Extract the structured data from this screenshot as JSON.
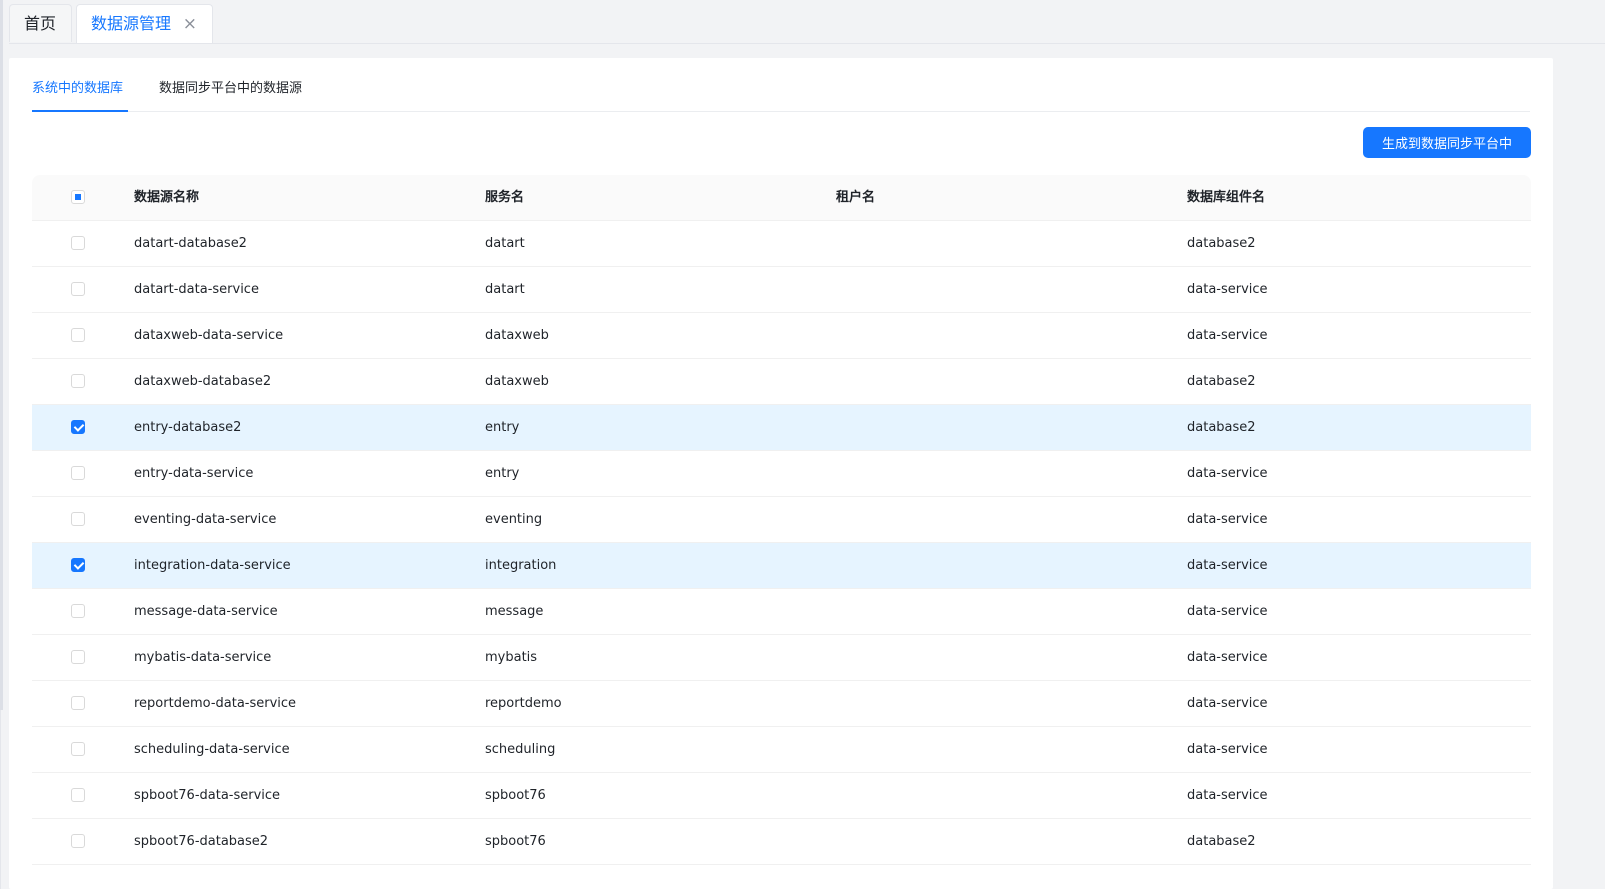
{
  "page_tabs": {
    "home_label": "首页",
    "active_label": "数据源管理",
    "close_glyph": "×"
  },
  "inner_tabs": [
    {
      "label": "系统中的数据库"
    },
    {
      "label": "数据同步平台中的数据源"
    }
  ],
  "toolbar": {
    "generate_label": "生成到数据同步平台中"
  },
  "table": {
    "columns": [
      "数据源名称",
      "服务名",
      "租户名",
      "数据库组件名"
    ],
    "header_checkbox": "indeterminate",
    "rows": [
      {
        "name": "datart-database2",
        "service": "datart",
        "tenant": "",
        "component": "database2",
        "checked": false
      },
      {
        "name": "datart-data-service",
        "service": "datart",
        "tenant": "",
        "component": "data-service",
        "checked": false
      },
      {
        "name": "dataxweb-data-service",
        "service": "dataxweb",
        "tenant": "",
        "component": "data-service",
        "checked": false
      },
      {
        "name": "dataxweb-database2",
        "service": "dataxweb",
        "tenant": "",
        "component": "database2",
        "checked": false
      },
      {
        "name": "entry-database2",
        "service": "entry",
        "tenant": "",
        "component": "database2",
        "checked": true
      },
      {
        "name": "entry-data-service",
        "service": "entry",
        "tenant": "",
        "component": "data-service",
        "checked": false
      },
      {
        "name": "eventing-data-service",
        "service": "eventing",
        "tenant": "",
        "component": "data-service",
        "checked": false
      },
      {
        "name": "integration-data-service",
        "service": "integration",
        "tenant": "",
        "component": "data-service",
        "checked": true
      },
      {
        "name": "message-data-service",
        "service": "message",
        "tenant": "",
        "component": "data-service",
        "checked": false
      },
      {
        "name": "mybatis-data-service",
        "service": "mybatis",
        "tenant": "",
        "component": "data-service",
        "checked": false
      },
      {
        "name": "reportdemo-data-service",
        "service": "reportdemo",
        "tenant": "",
        "component": "data-service",
        "checked": false
      },
      {
        "name": "scheduling-data-service",
        "service": "scheduling",
        "tenant": "",
        "component": "data-service",
        "checked": false
      },
      {
        "name": "spboot76-data-service",
        "service": "spboot76",
        "tenant": "",
        "component": "data-service",
        "checked": false
      },
      {
        "name": "spboot76-database2",
        "service": "spboot76",
        "tenant": "",
        "component": "database2",
        "checked": false
      }
    ]
  },
  "colors": {
    "accent": "#1677ff",
    "selected_row": "#e6f4ff"
  }
}
